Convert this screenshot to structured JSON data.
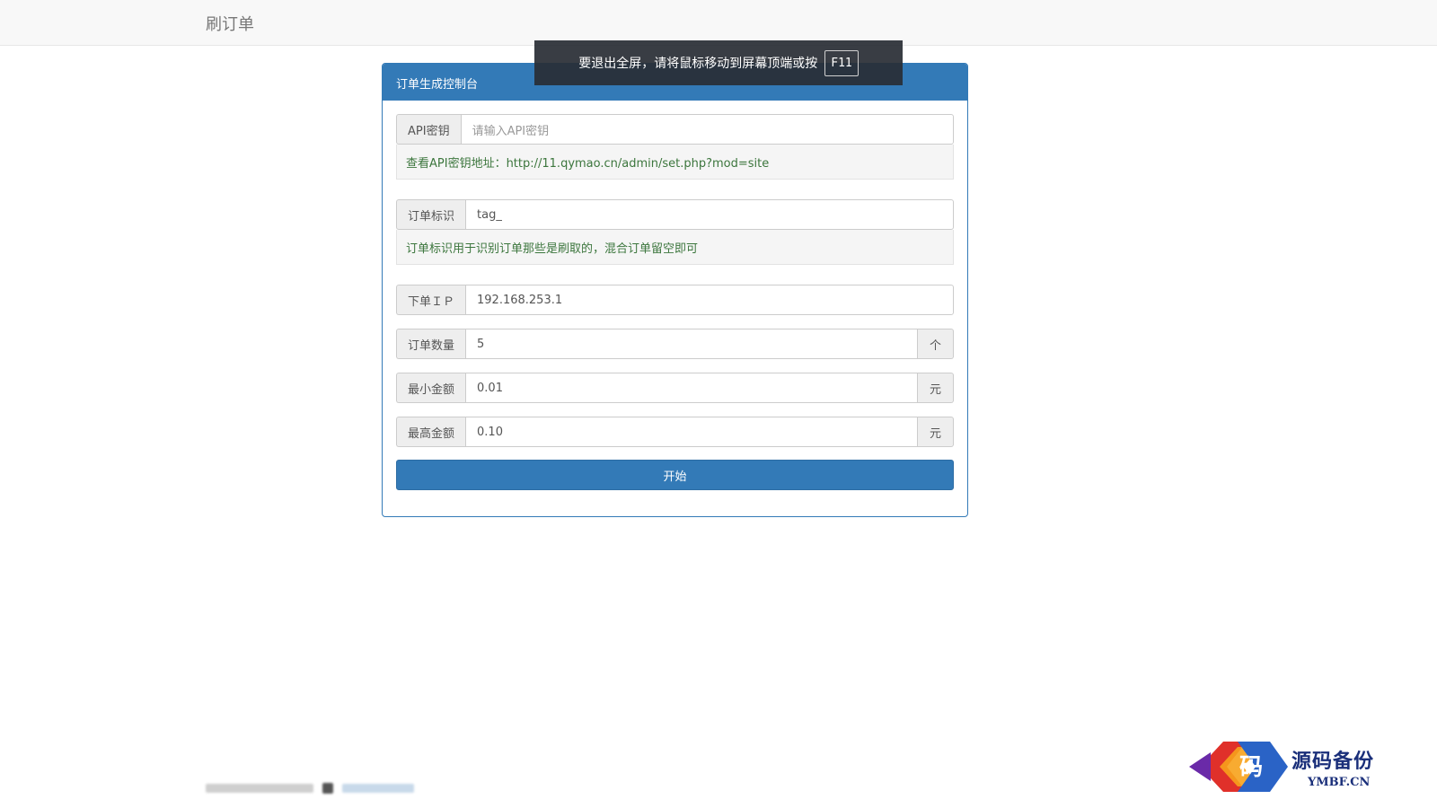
{
  "navbar": {
    "brand": "刷订单"
  },
  "fullscreen_notice": {
    "text": "要退出全屏，请将鼠标移动到屏幕顶端或按",
    "key": "F11"
  },
  "panel": {
    "title": "订单生成控制台",
    "api_key": {
      "label": "API密钥",
      "placeholder": "请输入API密钥",
      "value": "",
      "help": "查看API密钥地址：http://11.qymao.cn/admin/set.php?mod=site"
    },
    "order_tag": {
      "label": "订单标识",
      "value": "tag_",
      "help": "订单标识用于识别订单那些是刷取的，混合订单留空即可"
    },
    "order_ip": {
      "label": "下单ＩＰ",
      "value": "192.168.253.1"
    },
    "order_count": {
      "label": "订单数量",
      "value": "5",
      "unit": "个"
    },
    "min_amount": {
      "label": "最小金额",
      "value": "0.01",
      "unit": "元"
    },
    "max_amount": {
      "label": "最高金额",
      "value": "0.10",
      "unit": "元"
    },
    "start_button": "开始"
  },
  "watermark": {
    "name": "源码备份",
    "domain": "YMBF.CN",
    "logo_char": "码"
  },
  "colors": {
    "primary": "#337ab7",
    "help_text": "#3c763d",
    "navbar_bg": "#f8f8f8"
  }
}
